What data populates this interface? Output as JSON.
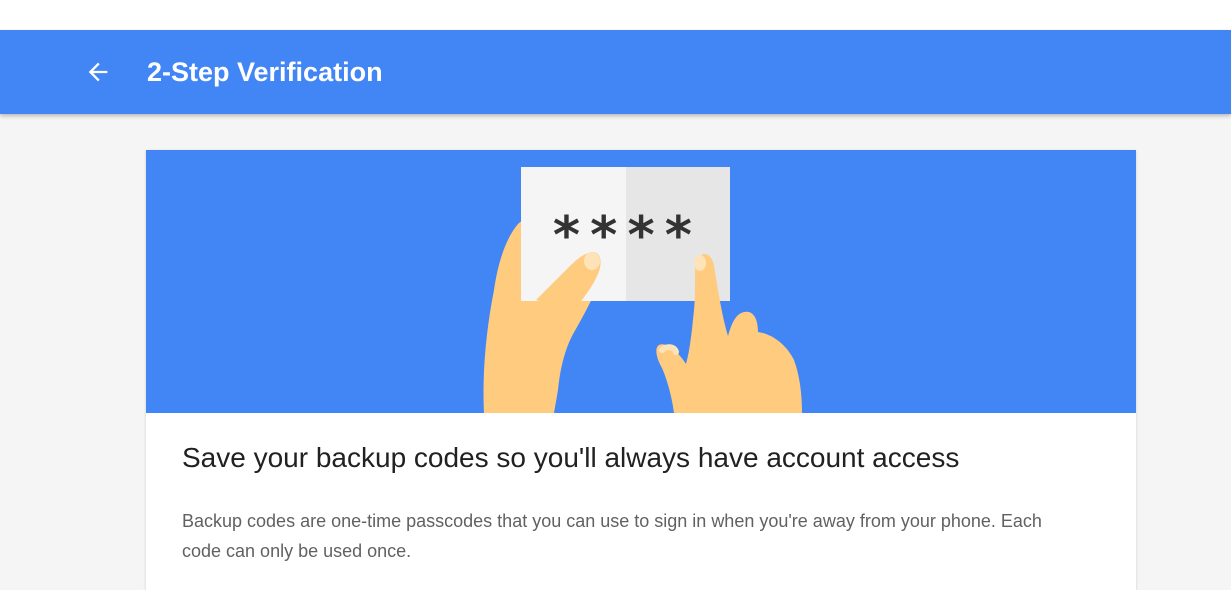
{
  "app_bar": {
    "title": "2-Step Verification",
    "back_icon": "arrow-back-icon",
    "background_color": "#4285f4"
  },
  "hero": {
    "background_color": "#4285f4",
    "illustration": "hands-holding-backup-codes-card",
    "card_text": "****"
  },
  "content": {
    "title": "Save your backup codes so you'll always have account access",
    "description": "Backup codes are one-time passcodes that you can use to sign in when you're away from your phone. Each code can only be used once."
  }
}
